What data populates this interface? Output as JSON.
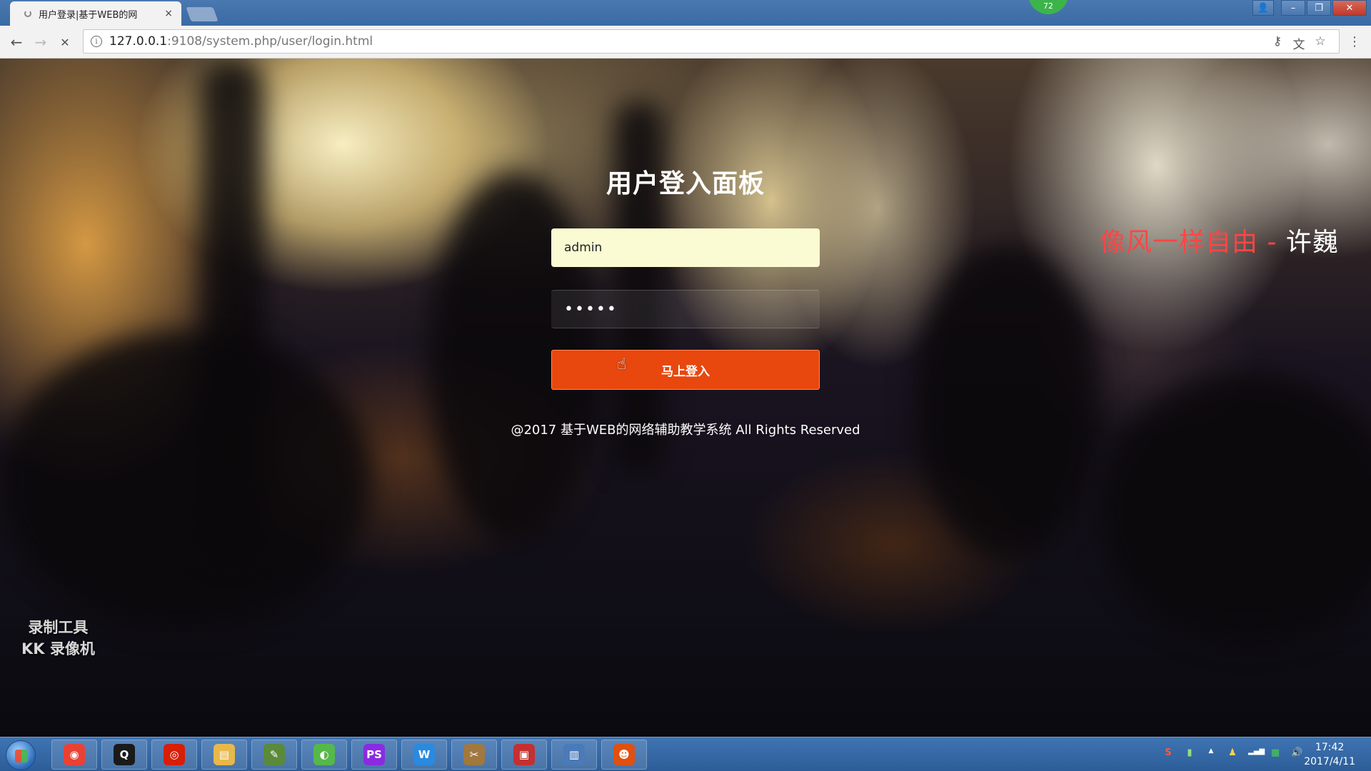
{
  "browser": {
    "tab_title": "用户登录|基于WEB的网",
    "tab_close": "×",
    "badge": "72",
    "url_host": "127.0.0.1",
    "url_rest": ":9108/system.php/user/login.html",
    "nav": {
      "back": "←",
      "forward": "→",
      "stop": "✕"
    },
    "omni_icons": {
      "key": "⚷",
      "translate": "文",
      "star": "☆"
    },
    "menu": "⋮",
    "window_controls": {
      "user": "👤",
      "minimize": "–",
      "maximize": "❐",
      "close": "✕"
    }
  },
  "login": {
    "title": "用户登入面板",
    "username_value": "admin",
    "password_mask": "•••••",
    "submit_label": "马上登入",
    "copyright": "@2017 基于WEB的网络辅助教学系统 All Rights Reserved"
  },
  "slogan": {
    "text": "像风一样自由 - ",
    "author": "许巍"
  },
  "watermark": {
    "line1": "录制工具",
    "line2": "KK 录像机"
  },
  "taskbar": {
    "apps": [
      {
        "name": "chrome-app",
        "glyph": "◉",
        "color": "#e94235"
      },
      {
        "name": "qq-app",
        "glyph": "Q",
        "color": "#1a1a1a"
      },
      {
        "name": "netease-music-app",
        "glyph": "◎",
        "color": "#d81e06"
      },
      {
        "name": "explorer-app",
        "glyph": "▤",
        "color": "#e8b84a"
      },
      {
        "name": "editor-app",
        "glyph": "✎",
        "color": "#5a8a3a"
      },
      {
        "name": "browser-app",
        "glyph": "◐",
        "color": "#56b84a"
      },
      {
        "name": "phpstorm-app",
        "glyph": "PS",
        "color": "#8a2be2"
      },
      {
        "name": "wps-app",
        "glyph": "W",
        "color": "#2a8ae0"
      },
      {
        "name": "tools-app",
        "glyph": "✂",
        "color": "#a07840"
      },
      {
        "name": "toolbox-app",
        "glyph": "▣",
        "color": "#c43030"
      },
      {
        "name": "screenshot-app",
        "glyph": "▥",
        "color": "#4a7ab8"
      },
      {
        "name": "recorder-app",
        "glyph": "☻",
        "color": "#e05010"
      }
    ],
    "tray": {
      "ime": "S",
      "battery": "▮",
      "expand": "▲",
      "qq": "♟",
      "signal": "▂▄▆",
      "monitor": "▦",
      "volume": "🔊"
    },
    "time": "17:42",
    "date": "2017/4/11"
  }
}
